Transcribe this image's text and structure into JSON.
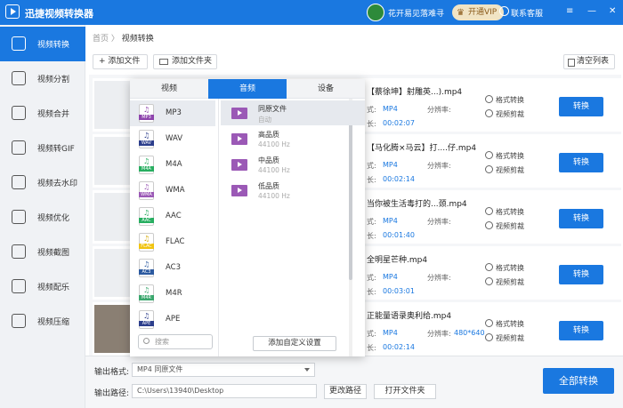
{
  "app": {
    "title": "迅捷视频转换器"
  },
  "header": {
    "username": "花开易见落难寻",
    "vip_label": "开通VIP",
    "service_label": "联系客服"
  },
  "sidebar": {
    "items": [
      {
        "label": "视频转换",
        "icon": "video-convert-icon"
      },
      {
        "label": "视频分割",
        "icon": "split-icon"
      },
      {
        "label": "视频合并",
        "icon": "merge-icon"
      },
      {
        "label": "视频转GIF",
        "icon": "gif-icon"
      },
      {
        "label": "视频去水印",
        "icon": "watermark-icon"
      },
      {
        "label": "视频优化",
        "icon": "optimize-icon"
      },
      {
        "label": "视频截图",
        "icon": "screenshot-icon"
      },
      {
        "label": "视频配乐",
        "icon": "music-icon"
      },
      {
        "label": "视频压缩",
        "icon": "compress-icon"
      }
    ]
  },
  "breadcrumb": {
    "home": "首页",
    "sep": " 〉",
    "current": "视频转换"
  },
  "toolbar": {
    "add_file": "+ 添加文件",
    "add_folder": "添加文件夹",
    "clear_list": "清空列表"
  },
  "files": [
    {
      "name": "【蔡徐坤】射雕英...).mp4",
      "fmt_label": "式:",
      "format": "MP4",
      "res_label": "分辨率:",
      "resolution": "",
      "dur_label": "长:",
      "duration": "00:02:07"
    },
    {
      "name": "【马化腾×马云】打....仔.mp4",
      "fmt_label": "式:",
      "format": "MP4",
      "res_label": "分辨率:",
      "resolution": "",
      "dur_label": "长:",
      "duration": "00:02:14"
    },
    {
      "name": "当你被生活毒打的...颈.mp4",
      "fmt_label": "式:",
      "format": "MP4",
      "res_label": "分辨率:",
      "resolution": "",
      "dur_label": "长:",
      "duration": "00:01:40"
    },
    {
      "name": "全明星芒种.mp4",
      "fmt_label": "式:",
      "format": "MP4",
      "res_label": "分辨率:",
      "resolution": "",
      "dur_label": "长:",
      "duration": "00:03:01"
    },
    {
      "name": "正能量语录奥利给.mp4",
      "fmt_label": "式:",
      "format": "MP4",
      "res_label": "分辨率:",
      "resolution": "480*640",
      "dur_label": "长:",
      "duration": "00:02:14"
    }
  ],
  "row_actions": {
    "format_convert": "格式转换",
    "video_cut": "视频剪裁",
    "convert": "转换"
  },
  "format_popup": {
    "tabs": [
      "视频",
      "音频",
      "设备"
    ],
    "formats": [
      {
        "name": "MP3",
        "color": "#8e44ad"
      },
      {
        "name": "WAV",
        "color": "#2c3e8c"
      },
      {
        "name": "M4A",
        "color": "#27ae60"
      },
      {
        "name": "WMA",
        "color": "#9b59b6"
      },
      {
        "name": "AAC",
        "color": "#27ae60"
      },
      {
        "name": "FLAC",
        "color": "#f1c40f"
      },
      {
        "name": "AC3",
        "color": "#2c5aa0"
      },
      {
        "name": "M4R",
        "color": "#3aa76d"
      },
      {
        "name": "APE",
        "color": "#2c3e8c"
      }
    ],
    "qualities": [
      {
        "name": "同原文件",
        "sub": "自动"
      },
      {
        "name": "高品质",
        "sub": "44100 Hz"
      },
      {
        "name": "中品质",
        "sub": "44100 Hz"
      },
      {
        "name": "低品质",
        "sub": "44100 Hz"
      }
    ],
    "search_placeholder": "搜索",
    "add_custom": "添加自定义设置"
  },
  "bottom": {
    "output_format_label": "输出格式:",
    "output_format_value": "MP4  同原文件",
    "output_path_label": "输出路径:",
    "output_path_value": "C:\\Users\\13940\\Desktop",
    "change_path": "更改路径",
    "open_folder": "打开文件夹",
    "convert_all": "全部转换"
  }
}
